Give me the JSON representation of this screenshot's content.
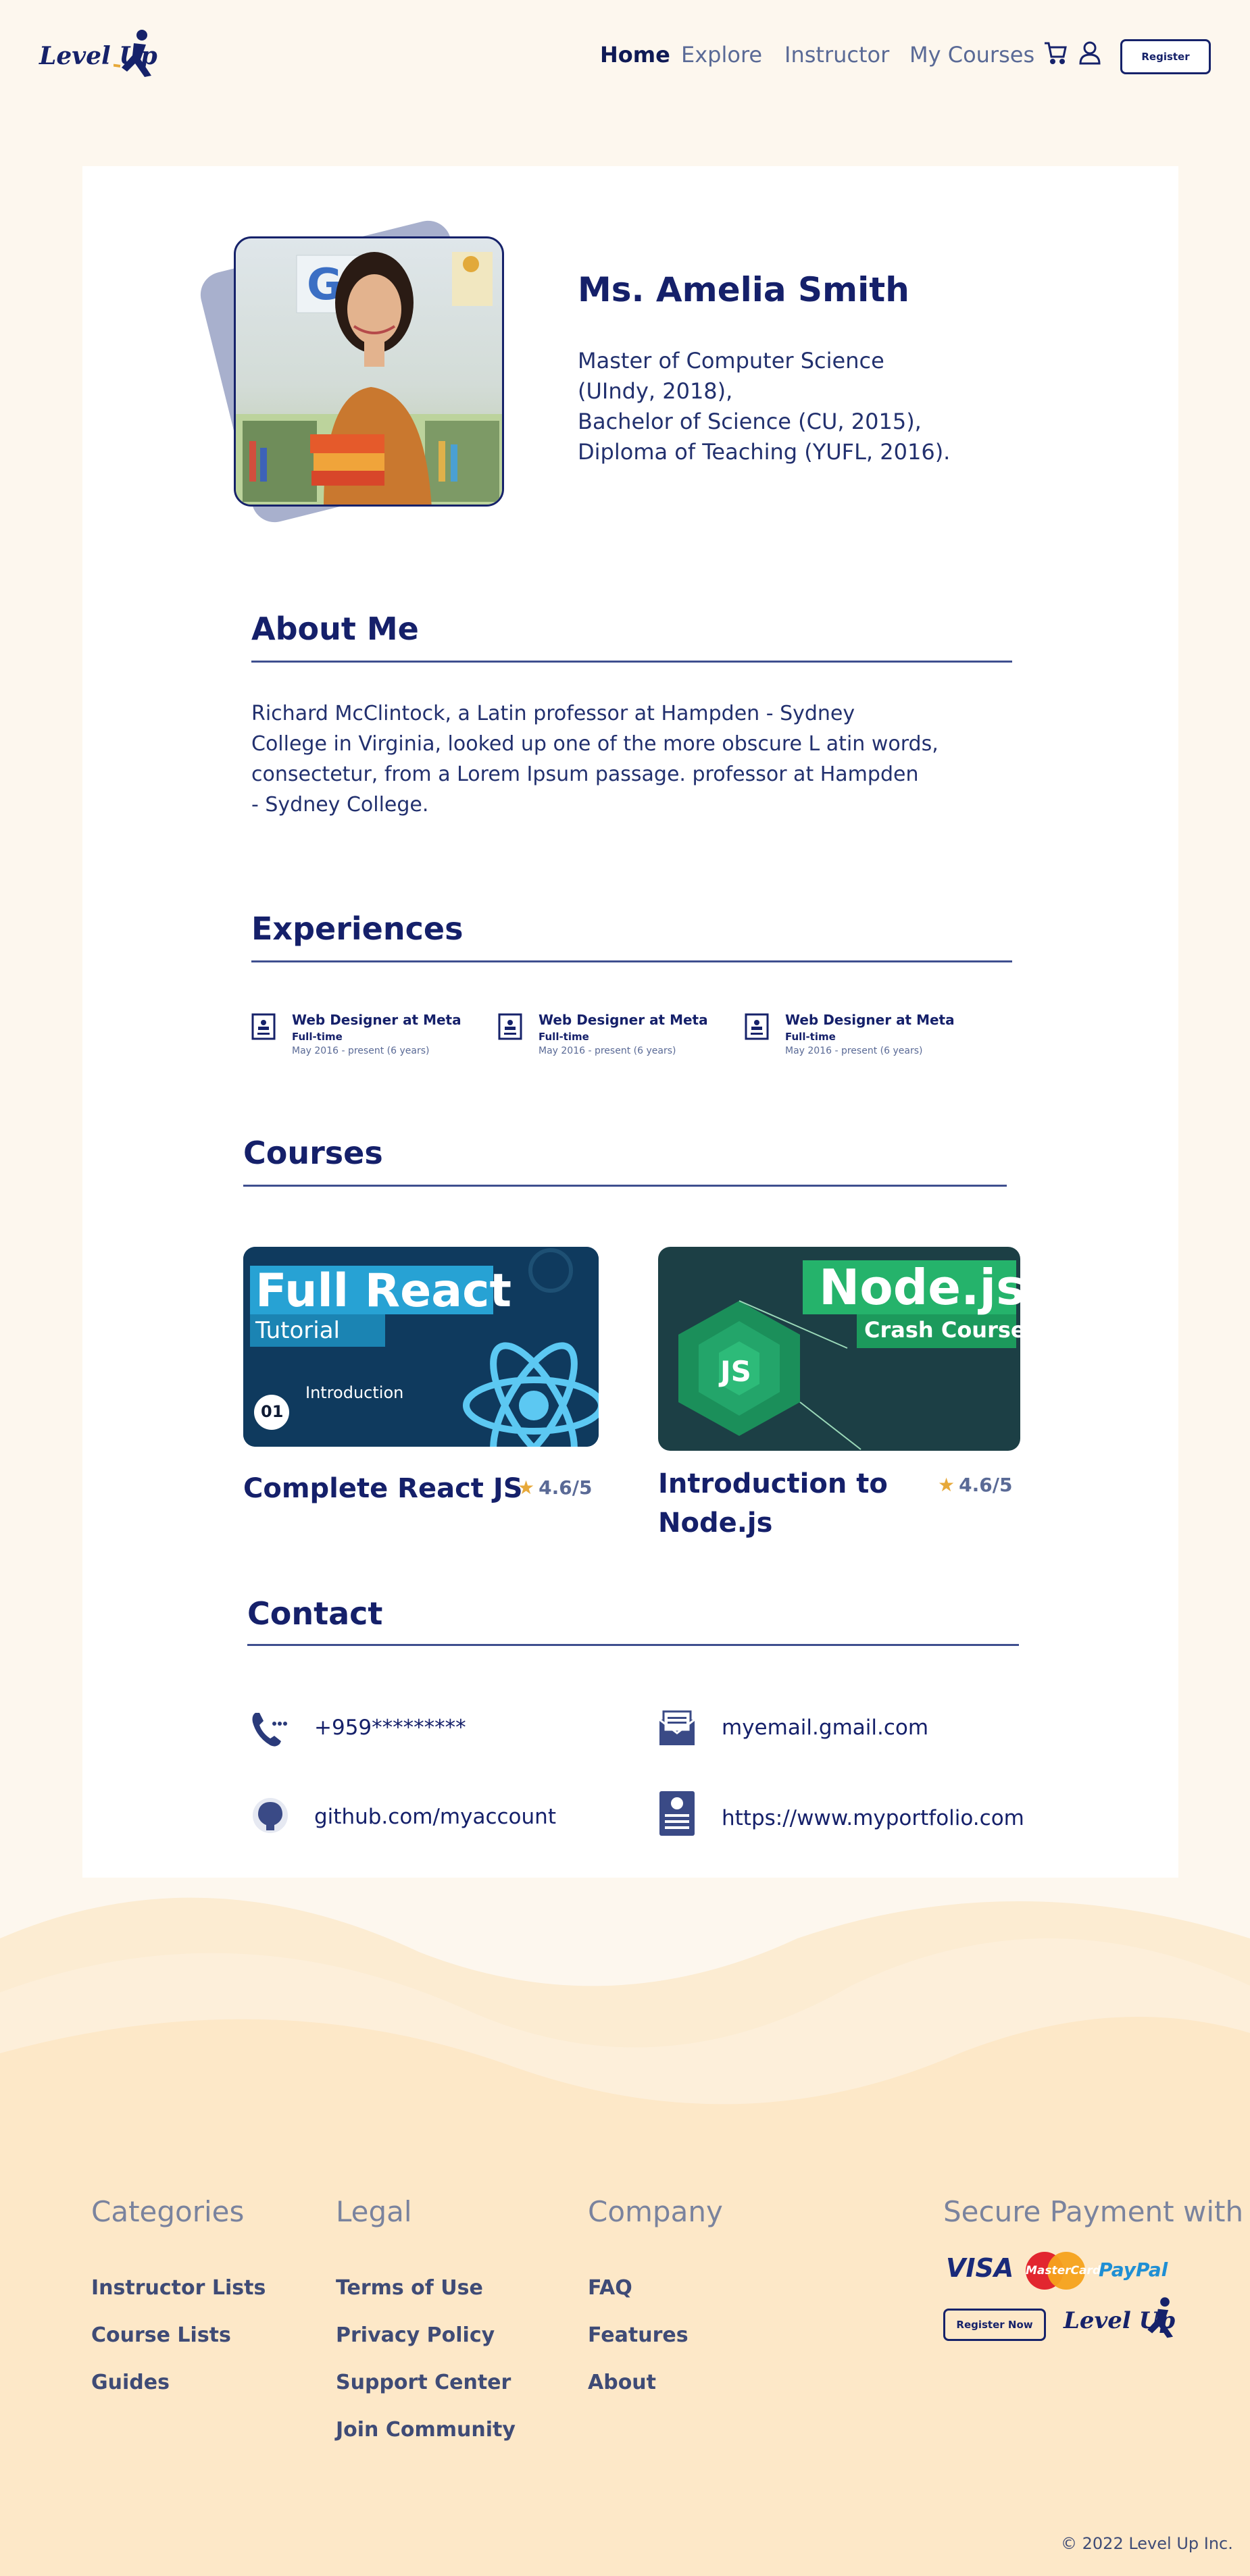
{
  "header": {
    "logo_text": "Level Up",
    "nav": [
      "Home",
      "Explore",
      "Instructor",
      "My Courses"
    ],
    "register_label": "Register"
  },
  "profile": {
    "name": "Ms. Amelia Smith",
    "degrees": [
      "Master of Computer Science",
      "(UIndy, 2018),",
      "Bachelor of Science (CU, 2015),",
      "Diploma of Teaching (YUFL, 2016)."
    ]
  },
  "about": {
    "title": "About Me",
    "lines": [
      "Richard McClintock, a Latin professor at Hampden - Sydney",
      "College in Virginia, looked up one of the more obscure  L atin words,",
      "consectetur, from a Lorem Ipsum passage.  professor at Hampden",
      "- Sydney College."
    ]
  },
  "experiences": {
    "title": "Experiences",
    "items": [
      {
        "title": "Web Designer at Meta",
        "type": "Full-time",
        "date": "May 2016 - present (6 years)"
      },
      {
        "title": "Web Designer at Meta",
        "type": "Full-time",
        "date": "May 2016 - present (6 years)"
      },
      {
        "title": "Web Designer at Meta",
        "type": "Full-time",
        "date": "May 2016 - present (6 years)"
      }
    ]
  },
  "courses": {
    "title": "Courses",
    "items": [
      {
        "name": "Complete React JS",
        "rating": "4.6/5",
        "thumb_title": "Full React",
        "thumb_sub": "Tutorial",
        "thumb_label": "Introduction",
        "thumb_num": "01"
      },
      {
        "name_lines": [
          "Introduction to",
          "Node.js"
        ],
        "rating": "4.6/5",
        "thumb_title": "Node.js",
        "thumb_sub": "Crash Course",
        "thumb_badge": "JS"
      }
    ]
  },
  "contact": {
    "title": "Contact",
    "phone": "+959*********",
    "email": "myemail.gmail.com",
    "github": "github.com/myaccount",
    "portfolio": "https://www.myportfolio.com"
  },
  "footer": {
    "categories": {
      "heading": "Categories",
      "links": [
        "Instructor Lists",
        "Course Lists",
        "Guides"
      ]
    },
    "legal": {
      "heading": "Legal",
      "links": [
        "Terms of Use",
        "Privacy Policy",
        "Support Center",
        "Join Community"
      ]
    },
    "company": {
      "heading": "Company",
      "links": [
        "FAQ",
        "Features",
        "About"
      ]
    },
    "payment": {
      "heading": "Secure Payment with",
      "visa": "VISA",
      "mastercard": "MasterCard",
      "paypal": "PayPal",
      "register_now": "Register Now",
      "logo_text": "Level Up"
    },
    "copyright": "© 2022 Level Up Inc."
  },
  "colors": {
    "primary": "#15206a",
    "accent_star": "#e7a93a",
    "footer_bg": "#fde9c8",
    "page_bg": "#fdf7ee"
  }
}
